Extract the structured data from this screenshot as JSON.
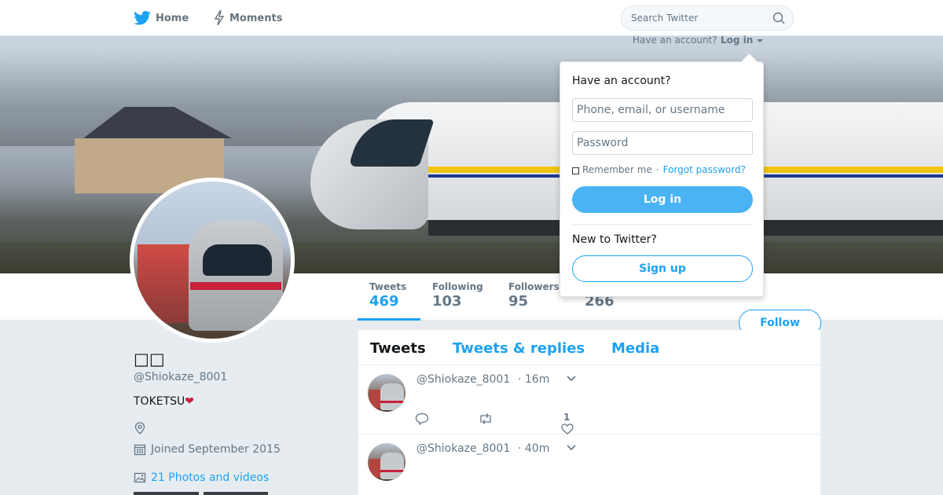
{
  "nav": {
    "home_label": "Home",
    "moments_label": "Moments",
    "search_placeholder": "Search Twitter"
  },
  "account_prompt": {
    "text": "Have an account?",
    "login_label": "Log in"
  },
  "login_dropdown": {
    "title": "Have an account?",
    "username_placeholder": "Phone, email, or username",
    "password_placeholder": "Password",
    "remember_label": "Remember me",
    "separator": "·",
    "forgot_label": "Forgot password?",
    "login_button": "Log in",
    "new_prompt": "New to Twitter?",
    "signup_button": "Sign up"
  },
  "profile": {
    "name": "□□",
    "handle": "@Shiokaze_8001",
    "bio": "TOKETSU",
    "bio_emoji": "❤",
    "joined": "Joined September 2015",
    "photos_label": "21 Photos and videos",
    "follow_label": "Follow"
  },
  "stats": {
    "tweets_label": "Tweets",
    "tweets_value": "469",
    "following_label": "Following",
    "following_value": "103",
    "followers_label": "Followers",
    "followers_value": "95",
    "likes_value": "266"
  },
  "timeline": {
    "tabs": [
      "Tweets",
      "Tweets & replies",
      "Media"
    ],
    "tweets": [
      {
        "handle": "@Shiokaze_8001",
        "time": "· 16m",
        "likes": "1"
      },
      {
        "handle": "@Shiokaze_8001",
        "time": "· 40m"
      }
    ]
  },
  "colors": {
    "accent": "#1da1f2",
    "background": "#e6ecf0",
    "login_button": "#4ab3f4"
  }
}
